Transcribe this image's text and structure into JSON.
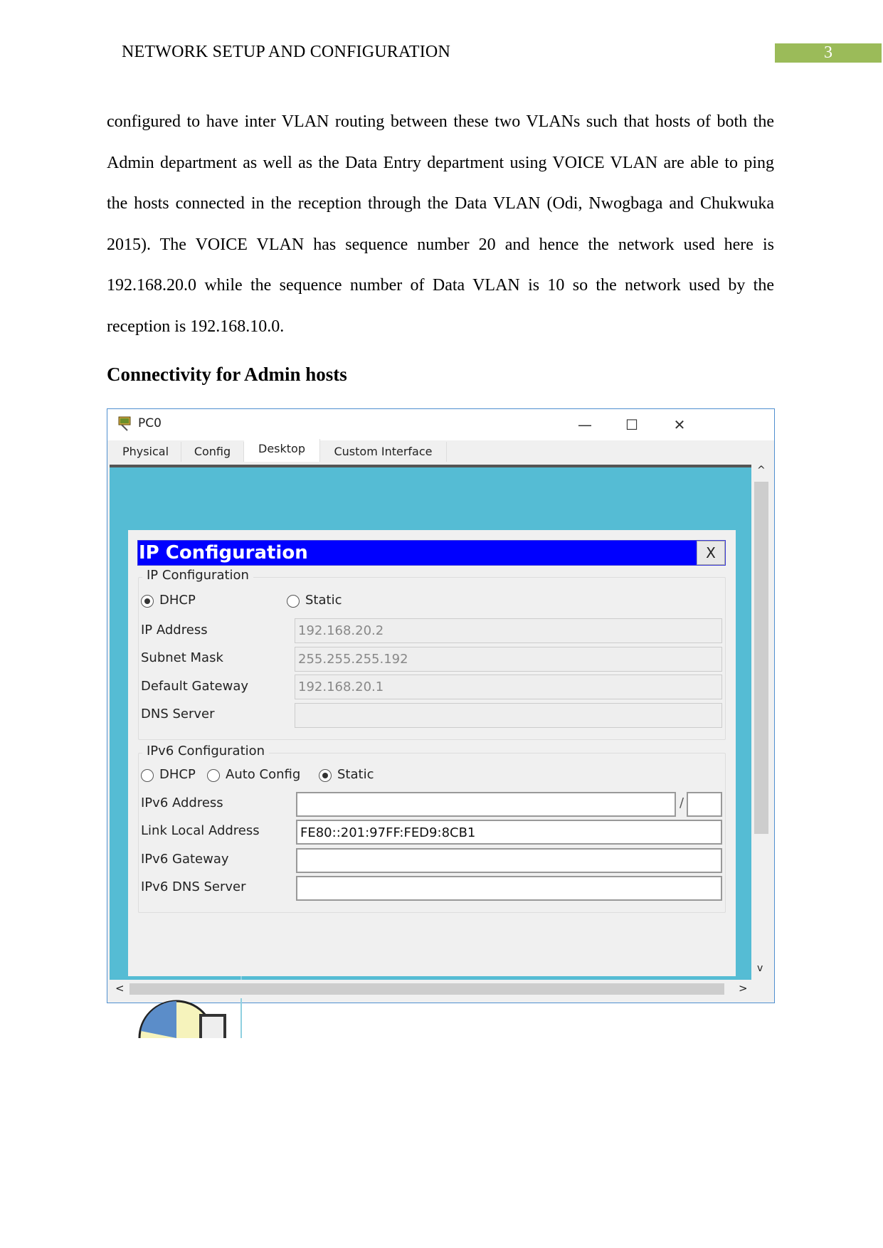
{
  "header": {
    "title": "NETWORK SETUP AND CONFIGURATION",
    "page_number": "3",
    "page_number_color": "#9bbb59"
  },
  "body": {
    "paragraph": "configured to have inter VLAN routing between these two VLANs such that hosts of both the Admin department as well as the Data Entry department using VOICE VLAN are able to ping the hosts connected in the reception through the Data VLAN (Odi, Nwogbaga and Chukwuka 2015). The VOICE VLAN has sequence number 20 and hence the network used here is 192.168.20.0 while the sequence number of Data VLAN is 10 so the network used by the reception is 192.168.10.0.",
    "heading": "Connectivity for Admin hosts"
  },
  "window": {
    "title": "PC0",
    "icon": "pc-icon",
    "controls": {
      "minimize": "—",
      "maximize": "☐",
      "close": "✕"
    },
    "tabs": [
      {
        "label": "Physical"
      },
      {
        "label": "Config"
      },
      {
        "label": "Desktop",
        "active": true
      },
      {
        "label": "Custom Interface"
      }
    ],
    "background_color": "#55bcd4",
    "dialog": {
      "title": "IP Configuration",
      "close": "X",
      "title_color": "#0000ff",
      "ipv4": {
        "legend": "IP Configuration",
        "mode_options": [
          {
            "label": "DHCP",
            "selected": true
          },
          {
            "label": "Static",
            "selected": false
          }
        ],
        "fields": [
          {
            "label": "IP Address",
            "value": "192.168.20.2"
          },
          {
            "label": "Subnet Mask",
            "value": "255.255.255.192"
          },
          {
            "label": "Default Gateway",
            "value": "192.168.20.1"
          },
          {
            "label": "DNS Server",
            "value": ""
          }
        ]
      },
      "ipv6": {
        "legend": "IPv6 Configuration",
        "mode_options": [
          {
            "label": "DHCP",
            "selected": false
          },
          {
            "label": "Auto Config",
            "selected": false
          },
          {
            "label": "Static",
            "selected": true
          }
        ],
        "address_label": "IPv6 Address",
        "address_value": "",
        "prefix_separator": "/",
        "prefix_value": "",
        "fields": [
          {
            "label": "Link Local Address",
            "value": "FE80::201:97FF:FED9:8CB1"
          },
          {
            "label": "IPv6 Gateway",
            "value": ""
          },
          {
            "label": "IPv6 DNS Server",
            "value": ""
          }
        ]
      }
    },
    "scroll": {
      "up": "^",
      "down": "v",
      "left": "<",
      "right": ">"
    }
  }
}
